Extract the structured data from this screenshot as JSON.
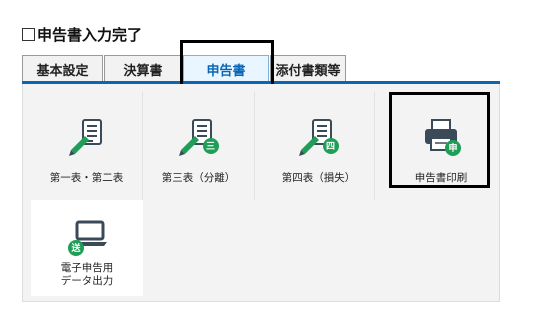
{
  "header": {
    "title": "申告書入力完了"
  },
  "tabs": [
    {
      "label": "基本設定"
    },
    {
      "label": "決算書"
    },
    {
      "label": "申告書"
    },
    {
      "label": "添付書類等"
    }
  ],
  "tiles": [
    {
      "label": "第一表・第二表",
      "badge": ""
    },
    {
      "label": "第三表（分離）",
      "badge": "三"
    },
    {
      "label": "第四表（損失）",
      "badge": "四"
    },
    {
      "label": "申告書印刷",
      "badge": "申"
    },
    {
      "label_line1": "電子申告用",
      "label_line2": "データ出力",
      "badge": "送"
    }
  ],
  "colors": {
    "accent_blue": "#0a66b5",
    "badge_green": "#1e9e57",
    "icon_dark": "#3b4a58"
  },
  "active_tab_index": 2
}
